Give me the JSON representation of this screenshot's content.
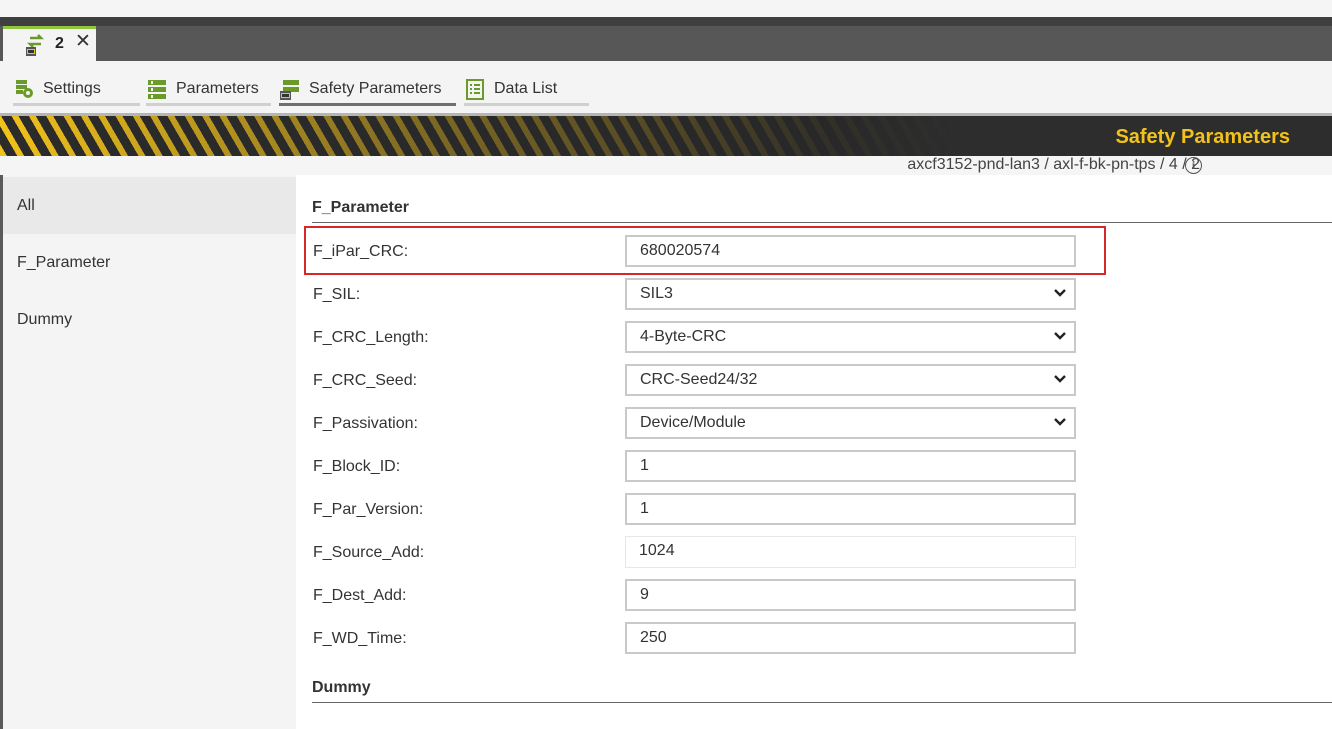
{
  "document_tab": {
    "label": "2",
    "close_glyph": "✕",
    "icon": "safety-transfer-icon"
  },
  "sub_tabs": [
    {
      "label": "Settings",
      "icon": "settings-gear-icon",
      "active": false
    },
    {
      "label": "Parameters",
      "icon": "parameters-icon",
      "active": false
    },
    {
      "label": "Safety Parameters",
      "icon": "safety-parameters-icon",
      "active": true
    },
    {
      "label": "Data List",
      "icon": "data-list-icon",
      "active": false
    }
  ],
  "banner": {
    "title": "Safety Parameters",
    "title_color": "#f2c21b",
    "stripe_colors": [
      "#f2c21b",
      "#2b2b2b"
    ]
  },
  "breadcrumb": "axcf3152-pnd-lan3 / axl-f-bk-pn-tps / 4 / 2",
  "sidebar": {
    "items": [
      {
        "label": "All",
        "active": true
      },
      {
        "label": "F_Parameter",
        "active": false
      },
      {
        "label": "Dummy",
        "active": false
      }
    ]
  },
  "sections": {
    "f_parameter": {
      "title": "F_Parameter"
    },
    "dummy": {
      "title": "Dummy"
    }
  },
  "params": [
    {
      "label": "F_iPar_CRC:",
      "value": "680020574",
      "kind": "text",
      "highlighted": true
    },
    {
      "label": "F_SIL:",
      "value": "SIL3",
      "kind": "select"
    },
    {
      "label": "F_CRC_Length:",
      "value": "4-Byte-CRC",
      "kind": "select"
    },
    {
      "label": "F_CRC_Seed:",
      "value": "CRC-Seed24/32",
      "kind": "select"
    },
    {
      "label": "F_Passivation:",
      "value": "Device/Module",
      "kind": "select"
    },
    {
      "label": "F_Block_ID:",
      "value": "1",
      "kind": "text"
    },
    {
      "label": "F_Par_Version:",
      "value": "1",
      "kind": "text"
    },
    {
      "label": "F_Source_Add:",
      "value": "1024",
      "kind": "readonly"
    },
    {
      "label": "F_Dest_Add:",
      "value": "9",
      "kind": "text"
    },
    {
      "label": "F_WD_Time:",
      "value": "250",
      "kind": "text"
    }
  ],
  "colors": {
    "accent_green": "#8dc63f",
    "highlight_red": "#d62828"
  }
}
